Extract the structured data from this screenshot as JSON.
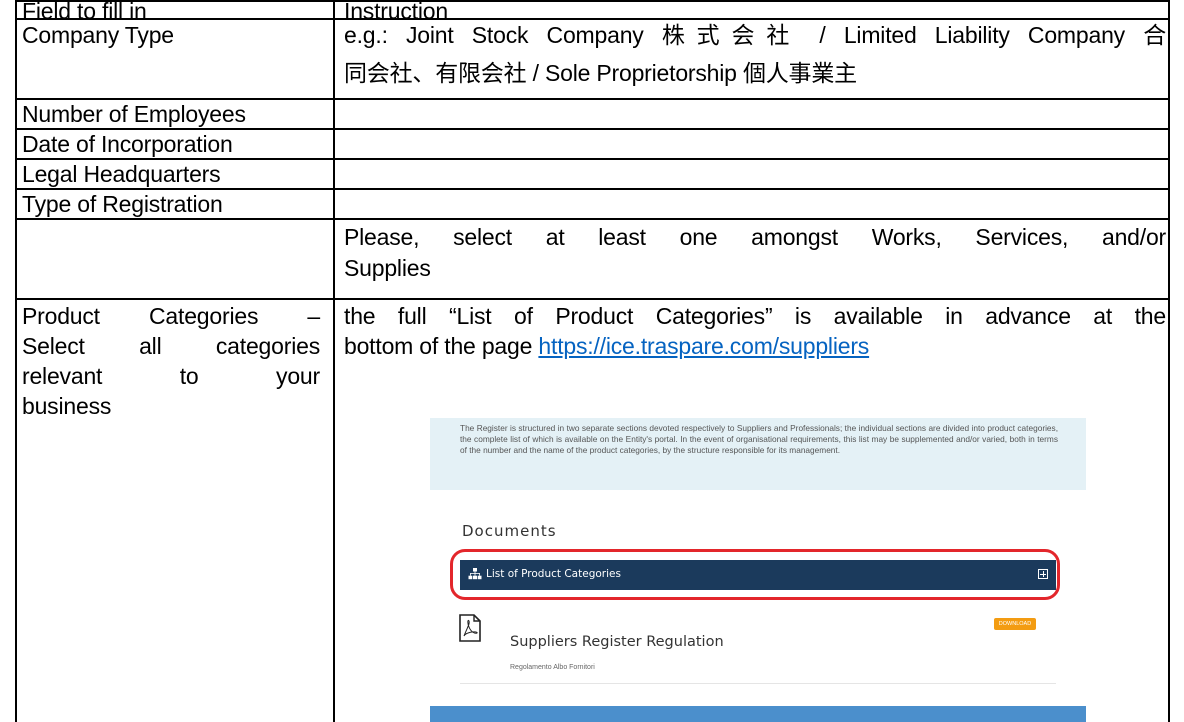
{
  "table": {
    "header": {
      "field": "Field to fill in",
      "instruction": "Instruction"
    },
    "rows": [
      {
        "field": "Company Type",
        "instruction_line1": "e.g.: Joint Stock Company 株式会社 / Limited Liability Company 合",
        "instruction_line2": "同会社、有限会社 / Sole Proprietorship 個人事業主"
      },
      {
        "field": "Number of Employees",
        "instruction": ""
      },
      {
        "field": "Date of Incorporation",
        "instruction": ""
      },
      {
        "field": "Legal Headquarters",
        "instruction": ""
      },
      {
        "field": "Type of Registration",
        "instruction_line1": "Please, select at least one amongst Works, Services, and/or",
        "instruction_line2": "Supplies"
      },
      {
        "field_line1": "Product Categories –",
        "field_line2": "Select all categories",
        "field_line3": "relevant to your",
        "field_line4": "business",
        "instruction_line1": "the full “List of Product Categories” is available in advance at the",
        "instruction_line2_prefix": "bottom of the page ",
        "link": "https://ice.traspare.com/suppliers"
      }
    ]
  },
  "screenshot": {
    "info_text": "The Register is structured in two separate sections devoted respectively to Suppliers and Professionals; the individual sections are divided into product categories, the complete list of which is available on the Entity's portal. In the event of organisational requirements, this list may be supplemented and/or varied, both in terms of the number and the name of the product categories, by the structure responsible for its management.",
    "documents_title": "Documents",
    "list_label": "List of Product Categories",
    "list_icon": "sitemap-icon",
    "expand_icon": "plus-square-icon",
    "doc_icon": "pdf-icon",
    "doc_title": "Suppliers Register Regulation",
    "doc_subtitle": "Regolamento Albo Fornitori",
    "download_label": "DOWNLOAD"
  },
  "colors": {
    "link": "#0563c1",
    "info_bg": "#e4f1f6",
    "bar": "#1b3a5c",
    "highlight": "#e3262b",
    "download": "#f39c12",
    "band": "#4b8fcc"
  }
}
